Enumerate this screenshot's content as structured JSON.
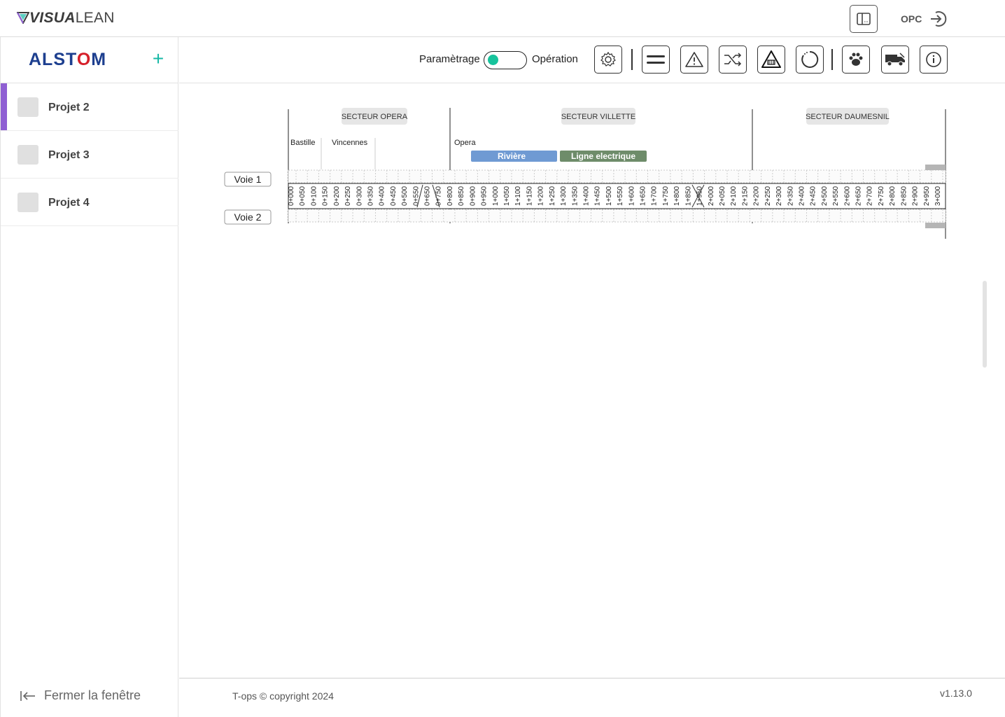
{
  "app": {
    "logo": "VISUALEAN",
    "logo_strong": "VISUA",
    "logo_rest": "LEAN",
    "user_label": "OPC"
  },
  "sidebar": {
    "brand": "ALSTOM",
    "projects": [
      {
        "label": "Projet 2",
        "active": true
      },
      {
        "label": "Projet 3",
        "active": false
      },
      {
        "label": "Projet 4",
        "active": false
      }
    ],
    "close_label": "Fermer la fenêtre"
  },
  "toolbar": {
    "mode_left": "Paramètrage",
    "mode_right": "Opération",
    "toggle_state": "Paramètrage",
    "toggle_color": "#17c39c",
    "buttons": [
      "gear-icon",
      "equals-icon",
      "warning-icon",
      "shuffle-icon",
      "road-warning-icon",
      "loading-icon",
      "paw-icon",
      "truck-icon",
      "info-icon"
    ]
  },
  "diagram": {
    "sectors": [
      "SECTEUR OPERA",
      "SECTEUR VILLETTE",
      "SECTEUR DAUMESNIL"
    ],
    "stations": [
      "Bastille",
      "Vincennes",
      "Opera"
    ],
    "zones": [
      {
        "label": "Rivière",
        "color": "#6f9ad3"
      },
      {
        "label": "Ligne electrique",
        "color": "#6e8c6a"
      }
    ],
    "tracks": [
      "Voie 1",
      "Voie 2"
    ],
    "km_labels": [
      "0+000",
      "0+050",
      "0+100",
      "0+150",
      "0+200",
      "0+250",
      "0+300",
      "0+350",
      "0+400",
      "0+450",
      "0+500",
      "0+550",
      "0+650",
      "0+750",
      "0+800",
      "0+850",
      "0+900",
      "0+950",
      "1+000",
      "1+050",
      "1+100",
      "1+150",
      "1+200",
      "1+250",
      "1+300",
      "1+350",
      "1+400",
      "1+450",
      "1+500",
      "1+550",
      "1+600",
      "1+650",
      "1+700",
      "1+750",
      "1+800",
      "1+850",
      "1+950",
      "2+000",
      "2+050",
      "2+100",
      "2+150",
      "2+200",
      "2+250",
      "2+300",
      "2+350",
      "2+400",
      "2+450",
      "2+500",
      "2+550",
      "2+600",
      "2+650",
      "2+700",
      "2+750",
      "2+800",
      "2+850",
      "2+900",
      "2+950",
      "3+000"
    ]
  },
  "footer": {
    "copyright": "T-ops © copyright 2024",
    "version": "v1.13.0"
  }
}
